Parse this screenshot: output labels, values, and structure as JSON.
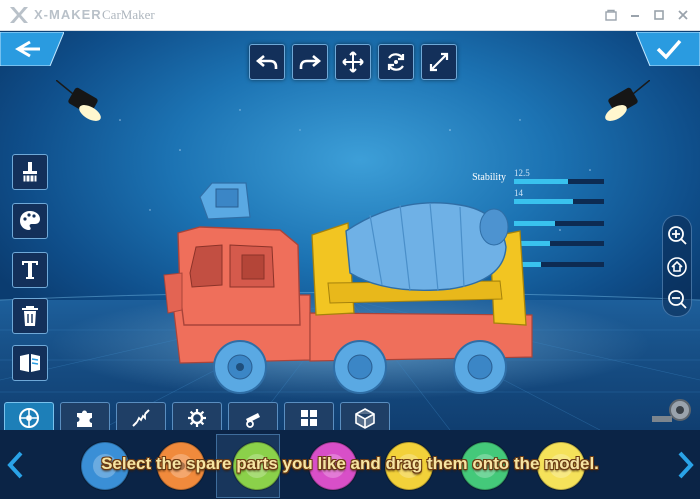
{
  "window": {
    "brand": "X-MAKER",
    "app_name": "CarMaker",
    "controls": [
      "store-icon",
      "minimize-icon",
      "maximize-icon",
      "close-icon"
    ]
  },
  "top_toolbar": {
    "buttons": [
      "undo-icon",
      "redo-icon",
      "move-icon",
      "rotate-icon",
      "scale-icon"
    ]
  },
  "corner_buttons": {
    "left": "back-icon",
    "right": "confirm-icon"
  },
  "side_toolbar": {
    "buttons": [
      "brush-icon",
      "palette-icon",
      "text-icon",
      "trash-icon",
      "book-icon"
    ]
  },
  "stats": {
    "items": [
      {
        "label": "Stability",
        "value": "12.5",
        "fill": 0.6
      },
      {
        "label": "",
        "value": "14",
        "fill": 0.65
      },
      {
        "label": "",
        "value": "",
        "fill": 0.45
      },
      {
        "label": "",
        "value": "",
        "fill": 0.4
      },
      {
        "label": "",
        "value": "",
        "fill": 0.3
      }
    ]
  },
  "zoom": {
    "buttons": [
      "zoom-in-icon",
      "home-icon",
      "zoom-out-icon"
    ]
  },
  "categories": {
    "active_index": 0,
    "tabs": [
      "wheel-icon",
      "puzzle-icon",
      "spring-icon",
      "gear-icon",
      "cannon-icon",
      "blocks-icon",
      "cube-icon"
    ]
  },
  "parts": {
    "colors": [
      "#3a8fd6",
      "#f08a3c",
      "#8bd14a",
      "#d84fc8",
      "#f2d13a",
      "#44c97a",
      "#f5e25a"
    ],
    "selected_index": 2
  },
  "caption": "Select the spare parts you like and drag them onto the model."
}
